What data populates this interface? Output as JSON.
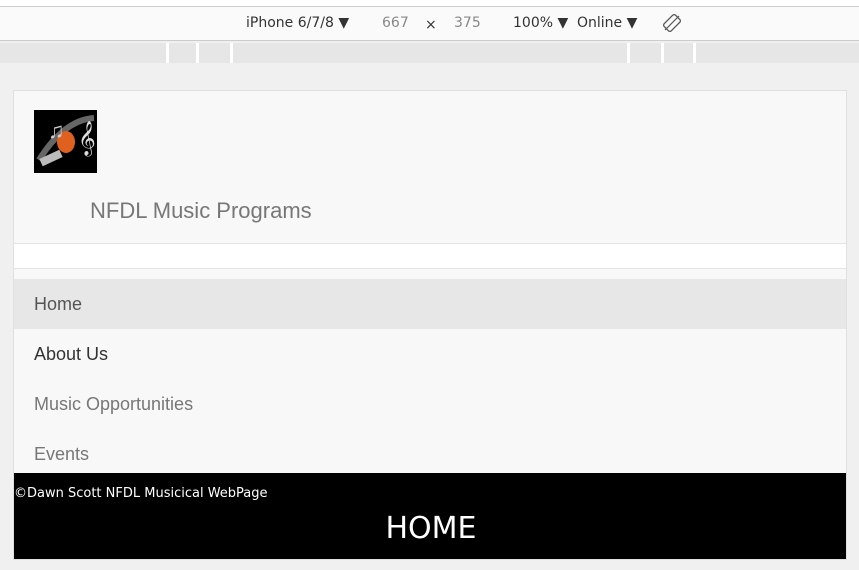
{
  "devtools": {
    "device": "iPhone 6/7/8 ▼",
    "width": "667",
    "times": "×",
    "height": "375",
    "zoom": "100% ▼",
    "network": "Online ▼"
  },
  "site": {
    "brand": "NFDL Music Programs",
    "nav": [
      {
        "label": "Home"
      },
      {
        "label": "About Us"
      },
      {
        "label": "Music Opportunities"
      },
      {
        "label": "Events"
      }
    ],
    "footer_copy": "©Dawn Scott NFDL Musicical WebPage",
    "footer_title": "HOME"
  }
}
